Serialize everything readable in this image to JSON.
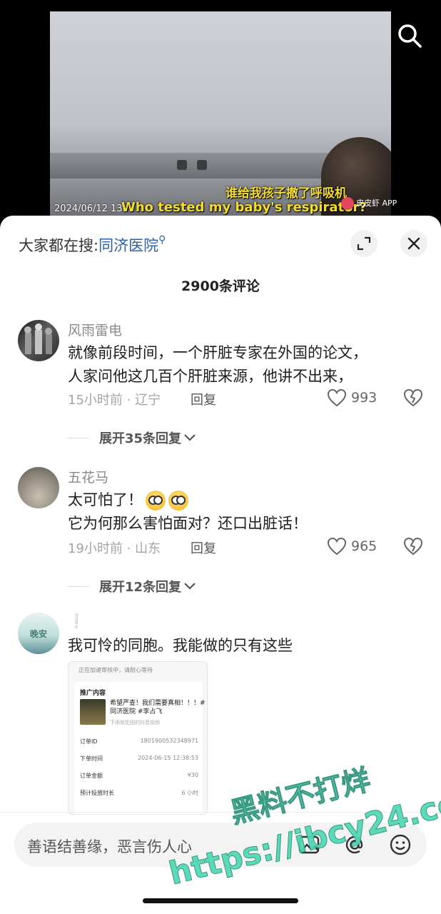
{
  "video": {
    "subtitle_zh": "谁给我孩子撤了呼吸机",
    "subtitle_en": "Who tested my baby's respirator?",
    "timestamp": "2024/06/12 13:...",
    "logo_text": "皮皮虾 APP"
  },
  "sheet": {
    "hot_search_prefix": "大家都在搜:",
    "hot_search_keyword": "同济医院",
    "comment_count": "2900条评论"
  },
  "comments": [
    {
      "username": "风雨雷电",
      "lines": [
        "就像前段时间，一个肝脏专家在外国的论文，",
        "人家问他这几百个肝脏来源，他讲不出来，"
      ],
      "meta": "15小时前 · 辽宁",
      "reply": "回复",
      "likes": "993",
      "expand": "展开35条回复"
    },
    {
      "username": "五花马",
      "lines": [
        "太可怕了！",
        "它为何那么害怕面对？还口出脏话！"
      ],
      "meta": "19小时前 · 山东",
      "reply": "回复",
      "likes": "965",
      "expand": "展开12条回复"
    },
    {
      "username": "",
      "lines": [
        "我可怜的同胞。我能做的只有这些"
      ],
      "avatar_text": "晚安"
    }
  ],
  "screenshot_card": {
    "top_note": "正在加速审核中，请耐心等待",
    "panel_title": "推广内容",
    "promo_line1": "希望严查！我们需要真相！！！#",
    "promo_line2": "同济医院 #李占飞",
    "promo_sub": "下雨就犯困的抖音视频",
    "rows": [
      {
        "label": "订单ID",
        "value": "1801900532348971"
      },
      {
        "label": "下单时间",
        "value": "2024-06-15 12:38:53"
      },
      {
        "label": "订单金额",
        "value": "¥30"
      },
      {
        "label": "预计投放时长",
        "value": "6 小时"
      }
    ]
  },
  "input": {
    "placeholder": "善语结善缘，恶言伤人心"
  },
  "watermark": {
    "line1": "黑料不打烊",
    "line2": "https://ibcy24.com"
  },
  "colors": {
    "accent": "#2b5fad",
    "watermark": "#4fd7b5"
  }
}
